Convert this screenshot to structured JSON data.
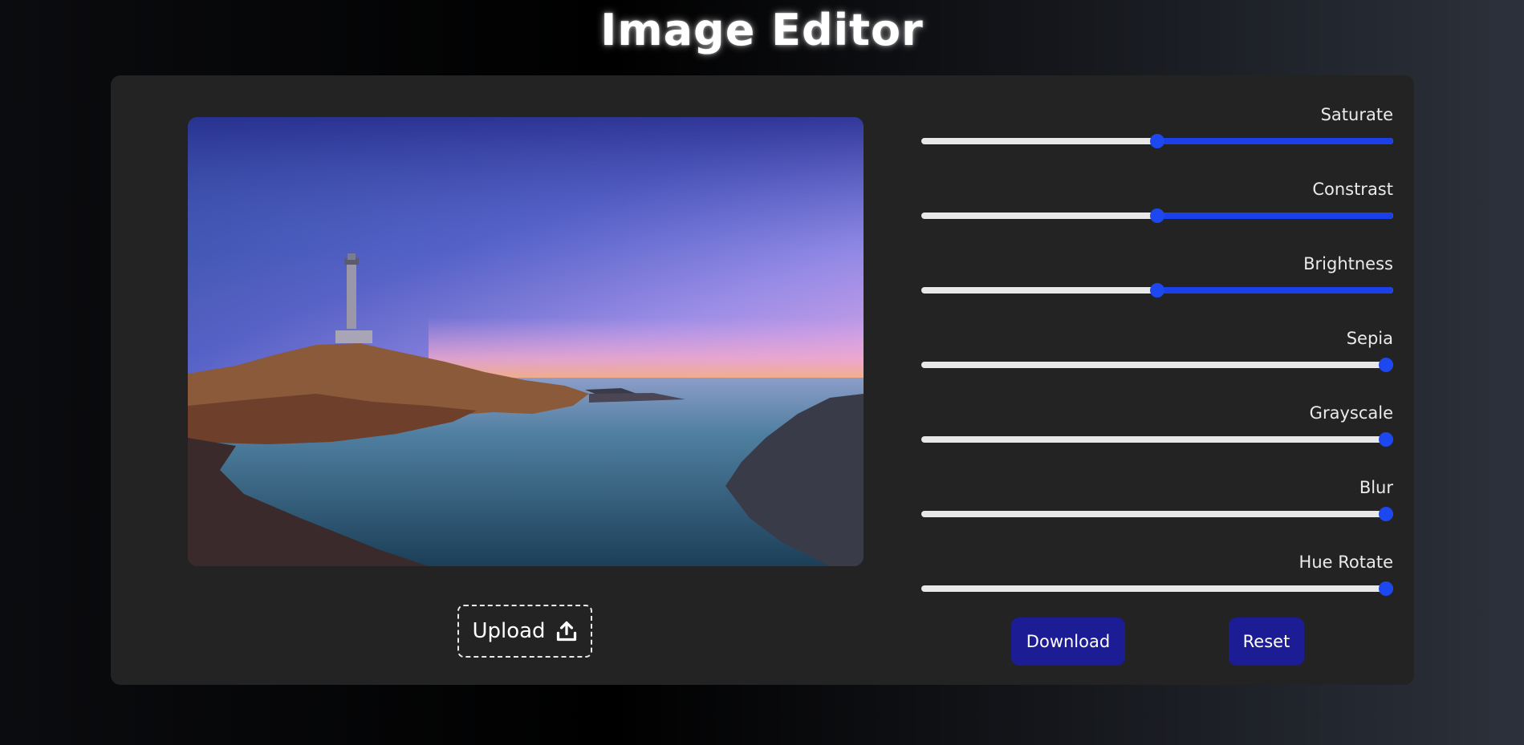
{
  "header": {
    "title": "Image Editor"
  },
  "upload": {
    "label": "Upload"
  },
  "sliders": [
    {
      "label": "Saturate",
      "value": 0.5
    },
    {
      "label": "Constrast",
      "value": 0.5
    },
    {
      "label": "Brightness",
      "value": 0.5
    },
    {
      "label": "Sepia",
      "value": 0.985
    },
    {
      "label": "Grayscale",
      "value": 0.985
    },
    {
      "label": "Blur",
      "value": 0.985
    },
    {
      "label": "Hue Rotate",
      "value": 0.985
    }
  ],
  "actions": {
    "download_label": "Download",
    "reset_label": "Reset"
  },
  "colors": {
    "accent": "#1b3fe8",
    "button": "#1c1c95",
    "panel": "#232323"
  }
}
